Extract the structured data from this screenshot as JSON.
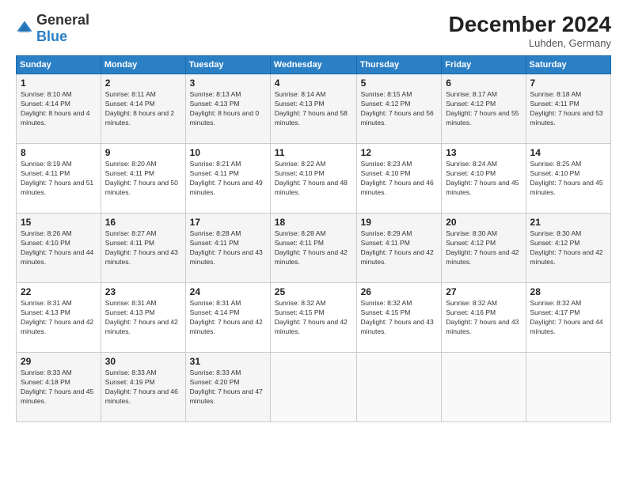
{
  "header": {
    "logo_general": "General",
    "logo_blue": "Blue",
    "title": "December 2024",
    "location": "Luhden, Germany"
  },
  "weekdays": [
    "Sunday",
    "Monday",
    "Tuesday",
    "Wednesday",
    "Thursday",
    "Friday",
    "Saturday"
  ],
  "weeks": [
    [
      {
        "day": "1",
        "sunrise": "Sunrise: 8:10 AM",
        "sunset": "Sunset: 4:14 PM",
        "daylight": "Daylight: 8 hours and 4 minutes."
      },
      {
        "day": "2",
        "sunrise": "Sunrise: 8:11 AM",
        "sunset": "Sunset: 4:14 PM",
        "daylight": "Daylight: 8 hours and 2 minutes."
      },
      {
        "day": "3",
        "sunrise": "Sunrise: 8:13 AM",
        "sunset": "Sunset: 4:13 PM",
        "daylight": "Daylight: 8 hours and 0 minutes."
      },
      {
        "day": "4",
        "sunrise": "Sunrise: 8:14 AM",
        "sunset": "Sunset: 4:13 PM",
        "daylight": "Daylight: 7 hours and 58 minutes."
      },
      {
        "day": "5",
        "sunrise": "Sunrise: 8:15 AM",
        "sunset": "Sunset: 4:12 PM",
        "daylight": "Daylight: 7 hours and 56 minutes."
      },
      {
        "day": "6",
        "sunrise": "Sunrise: 8:17 AM",
        "sunset": "Sunset: 4:12 PM",
        "daylight": "Daylight: 7 hours and 55 minutes."
      },
      {
        "day": "7",
        "sunrise": "Sunrise: 8:18 AM",
        "sunset": "Sunset: 4:11 PM",
        "daylight": "Daylight: 7 hours and 53 minutes."
      }
    ],
    [
      {
        "day": "8",
        "sunrise": "Sunrise: 8:19 AM",
        "sunset": "Sunset: 4:11 PM",
        "daylight": "Daylight: 7 hours and 51 minutes."
      },
      {
        "day": "9",
        "sunrise": "Sunrise: 8:20 AM",
        "sunset": "Sunset: 4:11 PM",
        "daylight": "Daylight: 7 hours and 50 minutes."
      },
      {
        "day": "10",
        "sunrise": "Sunrise: 8:21 AM",
        "sunset": "Sunset: 4:11 PM",
        "daylight": "Daylight: 7 hours and 49 minutes."
      },
      {
        "day": "11",
        "sunrise": "Sunrise: 8:22 AM",
        "sunset": "Sunset: 4:10 PM",
        "daylight": "Daylight: 7 hours and 48 minutes."
      },
      {
        "day": "12",
        "sunrise": "Sunrise: 8:23 AM",
        "sunset": "Sunset: 4:10 PM",
        "daylight": "Daylight: 7 hours and 46 minutes."
      },
      {
        "day": "13",
        "sunrise": "Sunrise: 8:24 AM",
        "sunset": "Sunset: 4:10 PM",
        "daylight": "Daylight: 7 hours and 45 minutes."
      },
      {
        "day": "14",
        "sunrise": "Sunrise: 8:25 AM",
        "sunset": "Sunset: 4:10 PM",
        "daylight": "Daylight: 7 hours and 45 minutes."
      }
    ],
    [
      {
        "day": "15",
        "sunrise": "Sunrise: 8:26 AM",
        "sunset": "Sunset: 4:10 PM",
        "daylight": "Daylight: 7 hours and 44 minutes."
      },
      {
        "day": "16",
        "sunrise": "Sunrise: 8:27 AM",
        "sunset": "Sunset: 4:11 PM",
        "daylight": "Daylight: 7 hours and 43 minutes."
      },
      {
        "day": "17",
        "sunrise": "Sunrise: 8:28 AM",
        "sunset": "Sunset: 4:11 PM",
        "daylight": "Daylight: 7 hours and 43 minutes."
      },
      {
        "day": "18",
        "sunrise": "Sunrise: 8:28 AM",
        "sunset": "Sunset: 4:11 PM",
        "daylight": "Daylight: 7 hours and 42 minutes."
      },
      {
        "day": "19",
        "sunrise": "Sunrise: 8:29 AM",
        "sunset": "Sunset: 4:11 PM",
        "daylight": "Daylight: 7 hours and 42 minutes."
      },
      {
        "day": "20",
        "sunrise": "Sunrise: 8:30 AM",
        "sunset": "Sunset: 4:12 PM",
        "daylight": "Daylight: 7 hours and 42 minutes."
      },
      {
        "day": "21",
        "sunrise": "Sunrise: 8:30 AM",
        "sunset": "Sunset: 4:12 PM",
        "daylight": "Daylight: 7 hours and 42 minutes."
      }
    ],
    [
      {
        "day": "22",
        "sunrise": "Sunrise: 8:31 AM",
        "sunset": "Sunset: 4:13 PM",
        "daylight": "Daylight: 7 hours and 42 minutes."
      },
      {
        "day": "23",
        "sunrise": "Sunrise: 8:31 AM",
        "sunset": "Sunset: 4:13 PM",
        "daylight": "Daylight: 7 hours and 42 minutes."
      },
      {
        "day": "24",
        "sunrise": "Sunrise: 8:31 AM",
        "sunset": "Sunset: 4:14 PM",
        "daylight": "Daylight: 7 hours and 42 minutes."
      },
      {
        "day": "25",
        "sunrise": "Sunrise: 8:32 AM",
        "sunset": "Sunset: 4:15 PM",
        "daylight": "Daylight: 7 hours and 42 minutes."
      },
      {
        "day": "26",
        "sunrise": "Sunrise: 8:32 AM",
        "sunset": "Sunset: 4:15 PM",
        "daylight": "Daylight: 7 hours and 43 minutes."
      },
      {
        "day": "27",
        "sunrise": "Sunrise: 8:32 AM",
        "sunset": "Sunset: 4:16 PM",
        "daylight": "Daylight: 7 hours and 43 minutes."
      },
      {
        "day": "28",
        "sunrise": "Sunrise: 8:32 AM",
        "sunset": "Sunset: 4:17 PM",
        "daylight": "Daylight: 7 hours and 44 minutes."
      }
    ],
    [
      {
        "day": "29",
        "sunrise": "Sunrise: 8:33 AM",
        "sunset": "Sunset: 4:18 PM",
        "daylight": "Daylight: 7 hours and 45 minutes."
      },
      {
        "day": "30",
        "sunrise": "Sunrise: 8:33 AM",
        "sunset": "Sunset: 4:19 PM",
        "daylight": "Daylight: 7 hours and 46 minutes."
      },
      {
        "day": "31",
        "sunrise": "Sunrise: 8:33 AM",
        "sunset": "Sunset: 4:20 PM",
        "daylight": "Daylight: 7 hours and 47 minutes."
      },
      null,
      null,
      null,
      null
    ]
  ]
}
